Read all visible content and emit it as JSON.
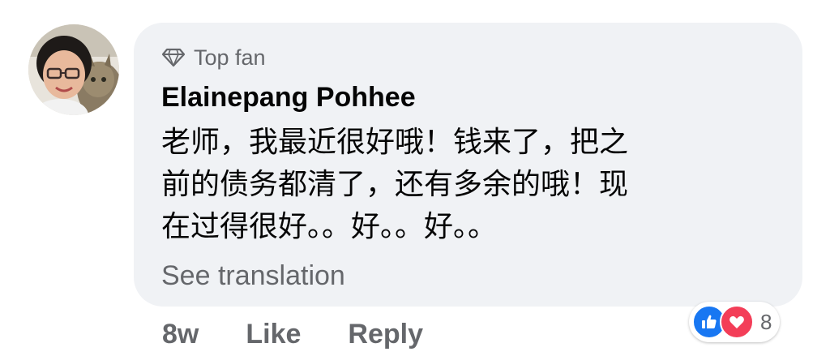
{
  "comment": {
    "badge": {
      "label": "Top fan",
      "icon": "diamond-icon"
    },
    "author": "Elainepang Pohhee",
    "text_lines": [
      "老师，我最近很好哦！钱来了，把之",
      "前的债务都清了，还有多余的哦！现",
      "在过得很好。。好。。好。。"
    ],
    "see_translation": "See translation"
  },
  "actions": {
    "time": "8w",
    "like": "Like",
    "reply": "Reply"
  },
  "reactions": {
    "icons": [
      "like-icon",
      "love-icon"
    ],
    "count": "8"
  },
  "colors": {
    "bubble": "#f0f2f5",
    "secondary_text": "#65676b",
    "like_blue": "#1877f2",
    "love_red": "#f33e58"
  }
}
